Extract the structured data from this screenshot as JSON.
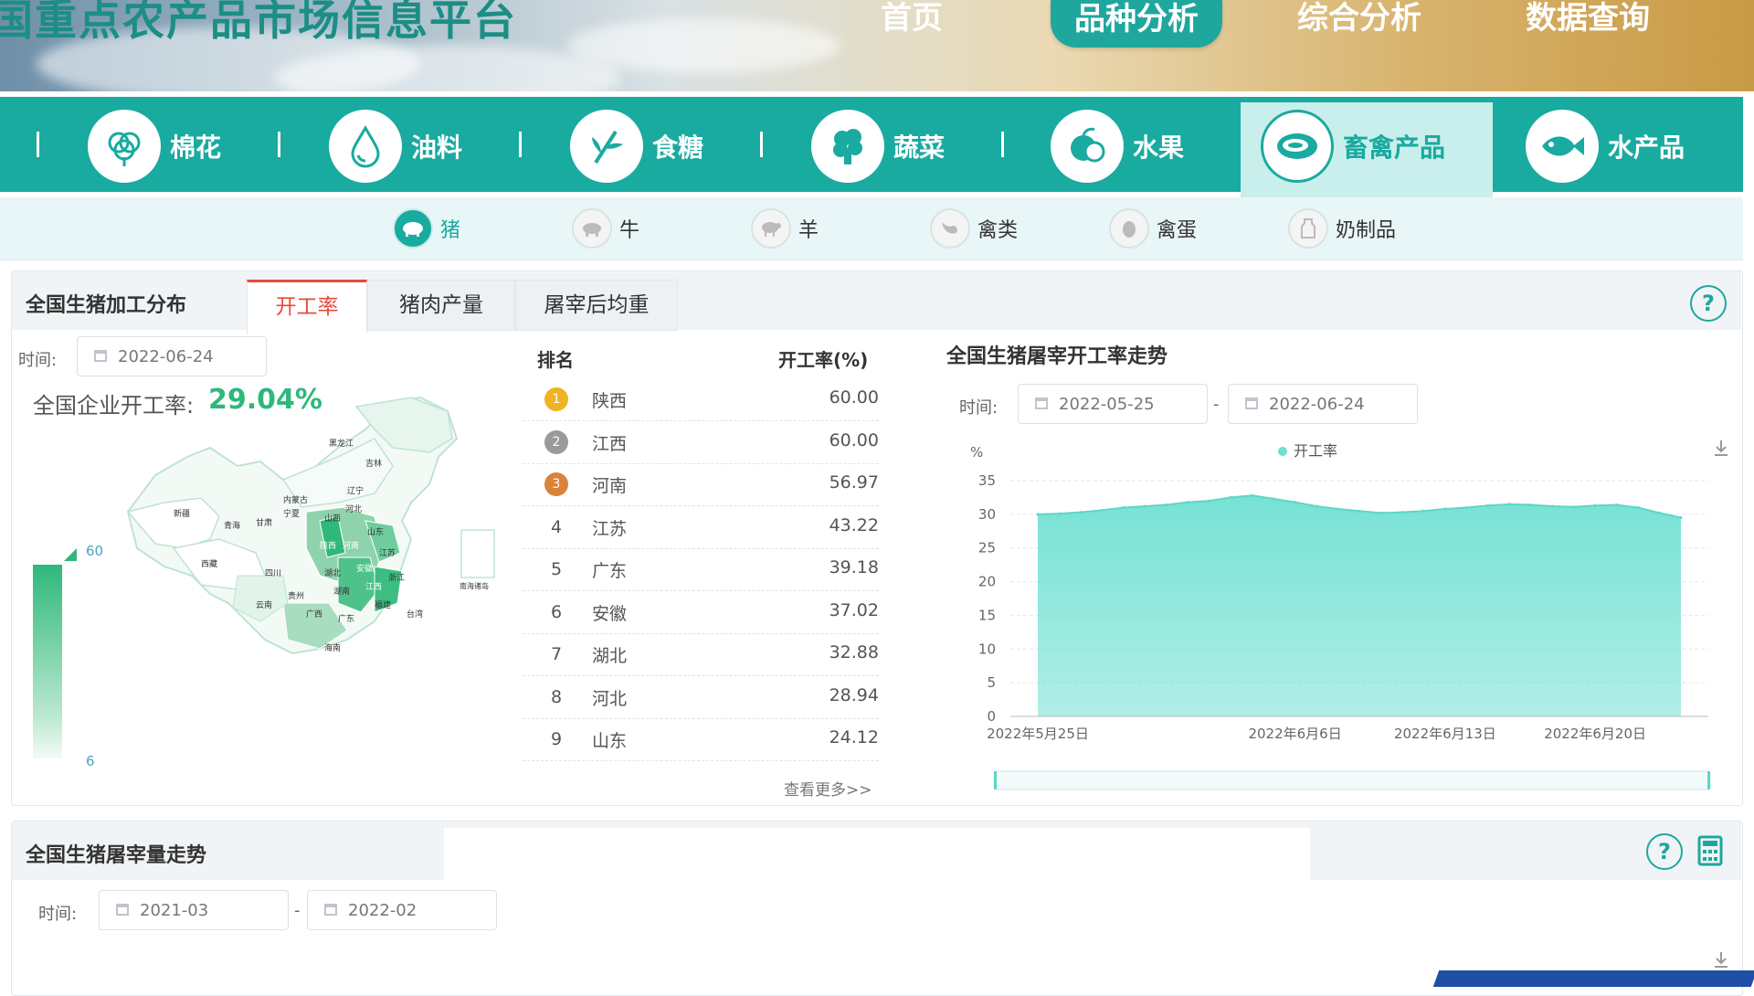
{
  "header": {
    "site_title": "国重点农产品市场信息平台",
    "nav": [
      "首页",
      "品种分析",
      "综合分析",
      "数据查询"
    ],
    "active_nav": "品种分析"
  },
  "categories": [
    {
      "label": "棉花",
      "icon": "cotton-icon"
    },
    {
      "label": "油料",
      "icon": "oil-drop-icon"
    },
    {
      "label": "食糖",
      "icon": "sugarcane-icon"
    },
    {
      "label": "蔬菜",
      "icon": "vegetable-icon"
    },
    {
      "label": "水果",
      "icon": "fruit-icon"
    },
    {
      "label": "畜禽产品",
      "icon": "meat-icon"
    },
    {
      "label": "水产品",
      "icon": "fish-icon"
    }
  ],
  "active_category": "畜禽产品",
  "subnav": [
    {
      "label": "猪",
      "icon": "pig-icon"
    },
    {
      "label": "牛",
      "icon": "cow-icon"
    },
    {
      "label": "羊",
      "icon": "sheep-icon"
    },
    {
      "label": "禽类",
      "icon": "poultry-icon"
    },
    {
      "label": "禽蛋",
      "icon": "egg-icon"
    },
    {
      "label": "奶制品",
      "icon": "milk-icon"
    }
  ],
  "active_sub": "猪",
  "panel1": {
    "title": "全国生猪加工分布",
    "tabs": [
      "开工率",
      "猪肉产量",
      "屠宰后均重"
    ],
    "active_tab": "开工率",
    "time_label": "时间:",
    "date": "2022-06-24",
    "rate_label": "全国企业开工率:",
    "rate_value": "29.04%",
    "legend_max": "60",
    "legend_min": "6",
    "map_labels": [
      "黑龙江",
      "吉林",
      "辽宁",
      "内蒙古",
      "新疆",
      "西藏",
      "青海",
      "甘肃",
      "宁夏",
      "四川",
      "陕西",
      "山西",
      "河北",
      "山东",
      "河南",
      "湖北",
      "安徽",
      "江苏",
      "浙江",
      "江西",
      "湖南",
      "福建",
      "广东",
      "广西",
      "贵州",
      "云南",
      "海南",
      "台湾",
      "南海诸岛"
    ],
    "table": {
      "col_rank": "排名",
      "col_rate": "开工率(%)",
      "rows": [
        {
          "rank": "1",
          "province": "陕西",
          "value": "60.00"
        },
        {
          "rank": "2",
          "province": "江西",
          "value": "60.00"
        },
        {
          "rank": "3",
          "province": "河南",
          "value": "56.97"
        },
        {
          "rank": "4",
          "province": "江苏",
          "value": "43.22"
        },
        {
          "rank": "5",
          "province": "广东",
          "value": "39.18"
        },
        {
          "rank": "6",
          "province": "安徽",
          "value": "37.02"
        },
        {
          "rank": "7",
          "province": "湖北",
          "value": "32.88"
        },
        {
          "rank": "8",
          "province": "河北",
          "value": "28.94"
        },
        {
          "rank": "9",
          "province": "山东",
          "value": "24.12"
        }
      ],
      "more": "查看更多>>"
    },
    "trend": {
      "title": "全国生猪屠宰开工率走势",
      "time_label": "时间:",
      "start": "2022-05-25",
      "end": "2022-06-24",
      "separator": "-"
    }
  },
  "chart_data": {
    "type": "area",
    "title": "全国生猪屠宰开工率走势",
    "ylabel": "%",
    "ylim": [
      0,
      35
    ],
    "yticks": [
      0,
      5,
      10,
      15,
      20,
      25,
      30,
      35
    ],
    "xticks": [
      "2022年5月25日",
      "2022年6月6日",
      "2022年6月13日",
      "2022年6月20日"
    ],
    "xtick_index": [
      0,
      12,
      19,
      26
    ],
    "series": [
      {
        "name": "开工率",
        "color": "#6fe0d2",
        "values": [
          30.0,
          30.1,
          30.3,
          30.6,
          31.0,
          31.2,
          31.4,
          31.8,
          32.0,
          32.5,
          32.8,
          32.3,
          31.8,
          31.2,
          30.8,
          30.5,
          30.2,
          30.3,
          30.5,
          30.8,
          31.0,
          31.3,
          31.5,
          31.4,
          31.2,
          31.1,
          31.3,
          31.4,
          31.0,
          30.2,
          29.5
        ]
      }
    ],
    "grid": true,
    "legend": "top-center"
  },
  "panel2": {
    "title": "全国生猪屠宰量走势",
    "time_label": "时间:",
    "start": "2021-03",
    "end": "2022-02",
    "separator": "-"
  },
  "colors": {
    "teal": "#19aaa0",
    "accent_red": "#e64b3c",
    "rate_green": "#2fb87a"
  }
}
